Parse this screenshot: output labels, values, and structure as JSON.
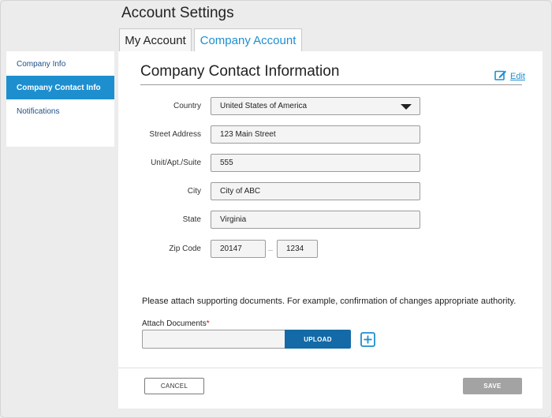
{
  "page": {
    "title": "Account Settings"
  },
  "tabs": [
    {
      "label": "My Account",
      "active": false
    },
    {
      "label": "Company Account",
      "active": true
    }
  ],
  "sidebar": {
    "items": [
      {
        "label": "Company Info",
        "active": false
      },
      {
        "label": "Company Contact Info",
        "active": true
      },
      {
        "label": "Notifications",
        "active": false
      }
    ]
  },
  "section": {
    "title": "Company Contact Information",
    "edit_label": "Edit"
  },
  "form": {
    "country": {
      "label": "Country",
      "value": "United States of America"
    },
    "street": {
      "label": "Street Address",
      "value": "123 Main Street"
    },
    "unit": {
      "label": "Unit/Apt./Suite",
      "value": "555"
    },
    "city": {
      "label": "City",
      "value": "City of ABC"
    },
    "state": {
      "label": "State",
      "value": "Virginia"
    },
    "zip": {
      "label": "Zip Code",
      "value": "20147",
      "ext": "1234"
    }
  },
  "attach": {
    "note": "Please attach supporting documents. For example, confirmation of changes appropriate authority.",
    "label": "Attach Documents",
    "required_mark": "*",
    "upload_label": "UPLOAD",
    "add_icon": "plus-square-icon"
  },
  "footer": {
    "cancel_label": "CANCEL",
    "save_label": "SAVE"
  },
  "colors": {
    "accent": "#1d8fcf",
    "upload": "#136aa7",
    "save_disabled": "#a3a3a3",
    "background": "#ececec"
  }
}
